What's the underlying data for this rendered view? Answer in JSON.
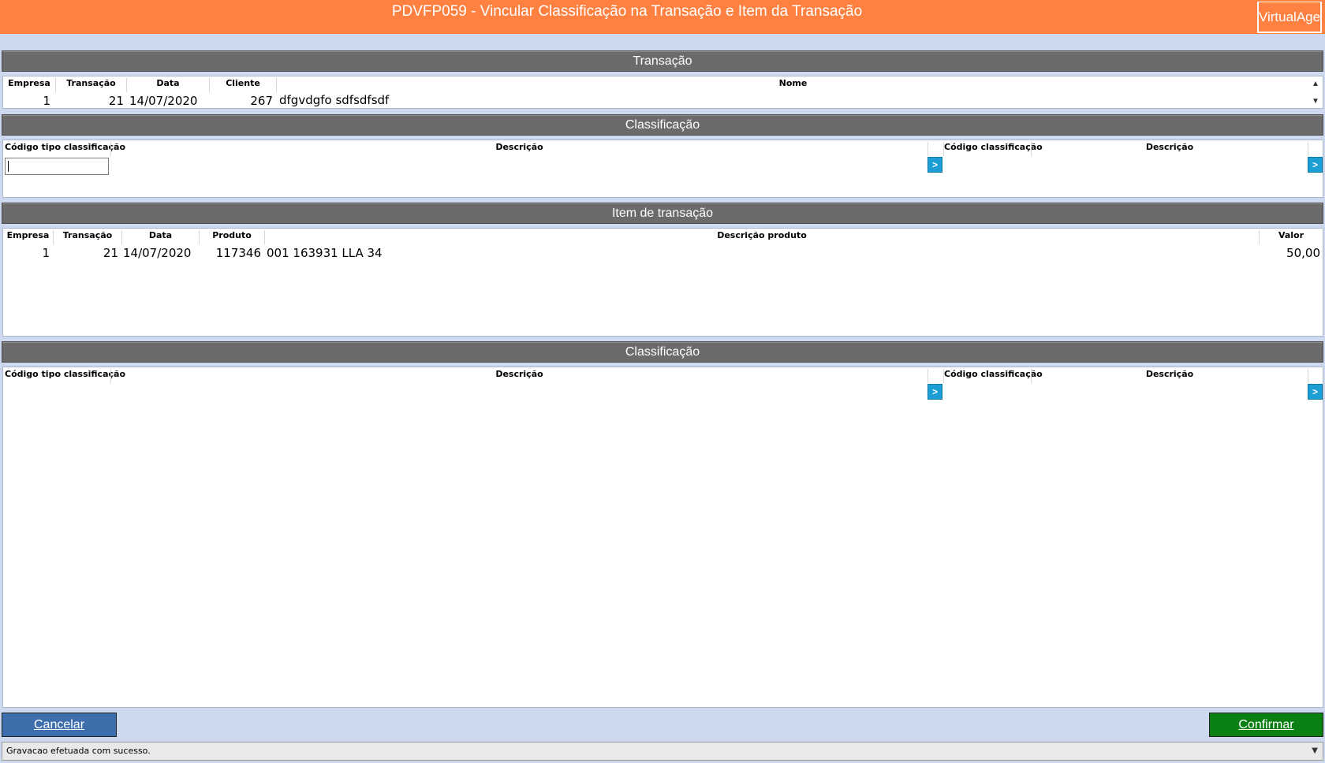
{
  "window": {
    "title": "PDVFP059 - Vincular Classificação na Transação e Item da Transação",
    "brand_button": "VirtualAge"
  },
  "transacao": {
    "section_title": "Transação",
    "columns": {
      "empresa": "Empresa",
      "transacao": "Transação",
      "data": "Data",
      "cliente": "Cliente",
      "nome": "Nome"
    },
    "row": {
      "empresa": "1",
      "transacao": "21",
      "data": "14/07/2020",
      "cliente": "267",
      "nome": "dfgvdgfo sdfsdfsdf"
    }
  },
  "classificacao_transacao": {
    "section_title": "Classificação",
    "columns": {
      "codigo_tipo": "Código tipo classificação",
      "descricao": "Descrição",
      "codigo_classificacao": "Código classificação",
      "descricao2": "Descrição"
    },
    "input_value": "",
    "arrow_label": ">"
  },
  "item_transacao": {
    "section_title": "Item de transação",
    "columns": {
      "empresa": "Empresa",
      "transacao": "Transação",
      "data": "Data",
      "produto": "Produto",
      "descricao_produto": "Descrição produto",
      "valor": "Valor"
    },
    "row": {
      "empresa": "1",
      "transacao": "21",
      "data": "14/07/2020",
      "produto": "117346",
      "descricao_produto": "001 163931 LLA 34",
      "valor": "50,00"
    }
  },
  "classificacao_item": {
    "section_title": "Classificação",
    "columns": {
      "codigo_tipo": "Código tipo classificação",
      "descricao": "Descrição",
      "codigo_classificacao": "Código classificação",
      "descricao2": "Descrição"
    },
    "arrow_label": ">"
  },
  "buttons": {
    "cancel": "Cancelar",
    "confirm": "Confirmar"
  },
  "status": {
    "message": "Gravacao efetuada com sucesso."
  },
  "icons": {
    "scroll_up": "chevron-up-icon",
    "scroll_down": "chevron-down-icon",
    "status_dropdown": "chevron-down-icon"
  },
  "colors": {
    "titlebar": "#ff8141",
    "section_header": "#6b6b6b",
    "background": "#ccd9ef",
    "arrow_button": "#1a9ed4",
    "cancel_button": "#3d6fad",
    "confirm_button": "#0a8012"
  }
}
